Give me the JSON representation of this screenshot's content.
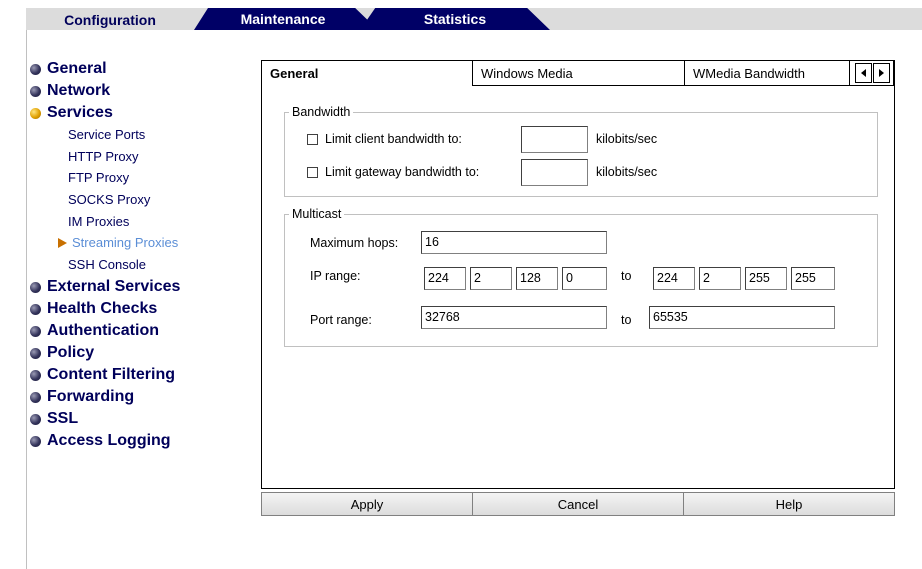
{
  "top_tabs": [
    {
      "label": "Configuration",
      "active": true
    },
    {
      "label": "Maintenance",
      "active": false
    },
    {
      "label": "Statistics",
      "active": false
    }
  ],
  "nav": {
    "general": "General",
    "network": "Network",
    "services": "Services",
    "services_sub": {
      "service_ports": "Service Ports",
      "http_proxy": "HTTP Proxy",
      "ftp_proxy": "FTP Proxy",
      "socks_proxy": "SOCKS Proxy",
      "im_proxies": "IM Proxies",
      "streaming_proxies": "Streaming Proxies",
      "ssh_console": "SSH Console"
    },
    "external_services": "External Services",
    "health_checks": "Health Checks",
    "authentication": "Authentication",
    "policy": "Policy",
    "content_filtering": "Content Filtering",
    "forwarding": "Forwarding",
    "ssl": "SSL",
    "access_logging": "Access Logging"
  },
  "content_tabs": [
    {
      "label": "General",
      "active": true
    },
    {
      "label": "Windows Media",
      "active": false
    },
    {
      "label": "WMedia Bandwidth",
      "active": false
    }
  ],
  "bandwidth": {
    "legend": "Bandwidth",
    "client_label": "Limit client bandwidth to:",
    "client_checked": false,
    "client_value": "",
    "gateway_label": "Limit gateway bandwidth to:",
    "gateway_checked": false,
    "gateway_value": "",
    "unit": "kilobits/sec"
  },
  "multicast": {
    "legend": "Multicast",
    "max_hops_label": "Maximum hops:",
    "max_hops_value": "16",
    "ip_range_label": "IP range:",
    "ip_from": [
      "224",
      "2",
      "128",
      "0"
    ],
    "ip_to": [
      "224",
      "2",
      "255",
      "255"
    ],
    "to_label": "to",
    "port_range_label": "Port range:",
    "port_from": "32768",
    "port_to": "65535"
  },
  "buttons": {
    "apply": "Apply",
    "cancel": "Cancel",
    "help": "Help"
  }
}
